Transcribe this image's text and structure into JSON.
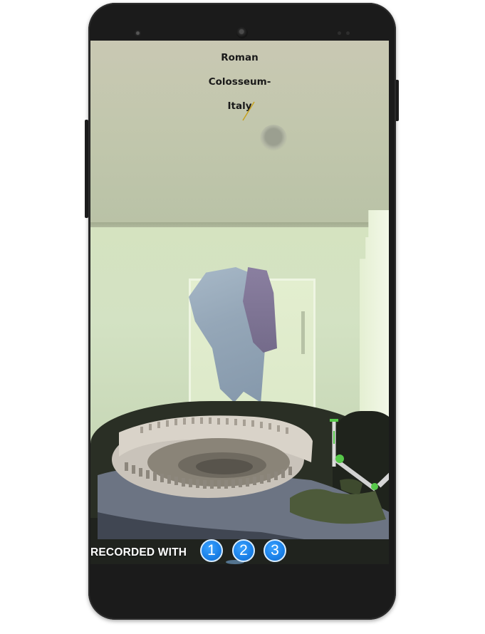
{
  "screen": {
    "title_lines": [
      "Roman",
      "Colosseum-",
      "Italy"
    ]
  },
  "bottom_bar": {
    "label": "RECORDED WITH",
    "buttons": [
      "1",
      "2",
      "3"
    ]
  },
  "colors": {
    "phone_body": "#1b1b1b",
    "button_blue": "#1a80e8",
    "gizmo_green": "#57c84a",
    "label_white": "#ffffff"
  },
  "icons": {
    "camera": "front-camera-icon",
    "gizmo": "transform-gizmo-icon"
  }
}
